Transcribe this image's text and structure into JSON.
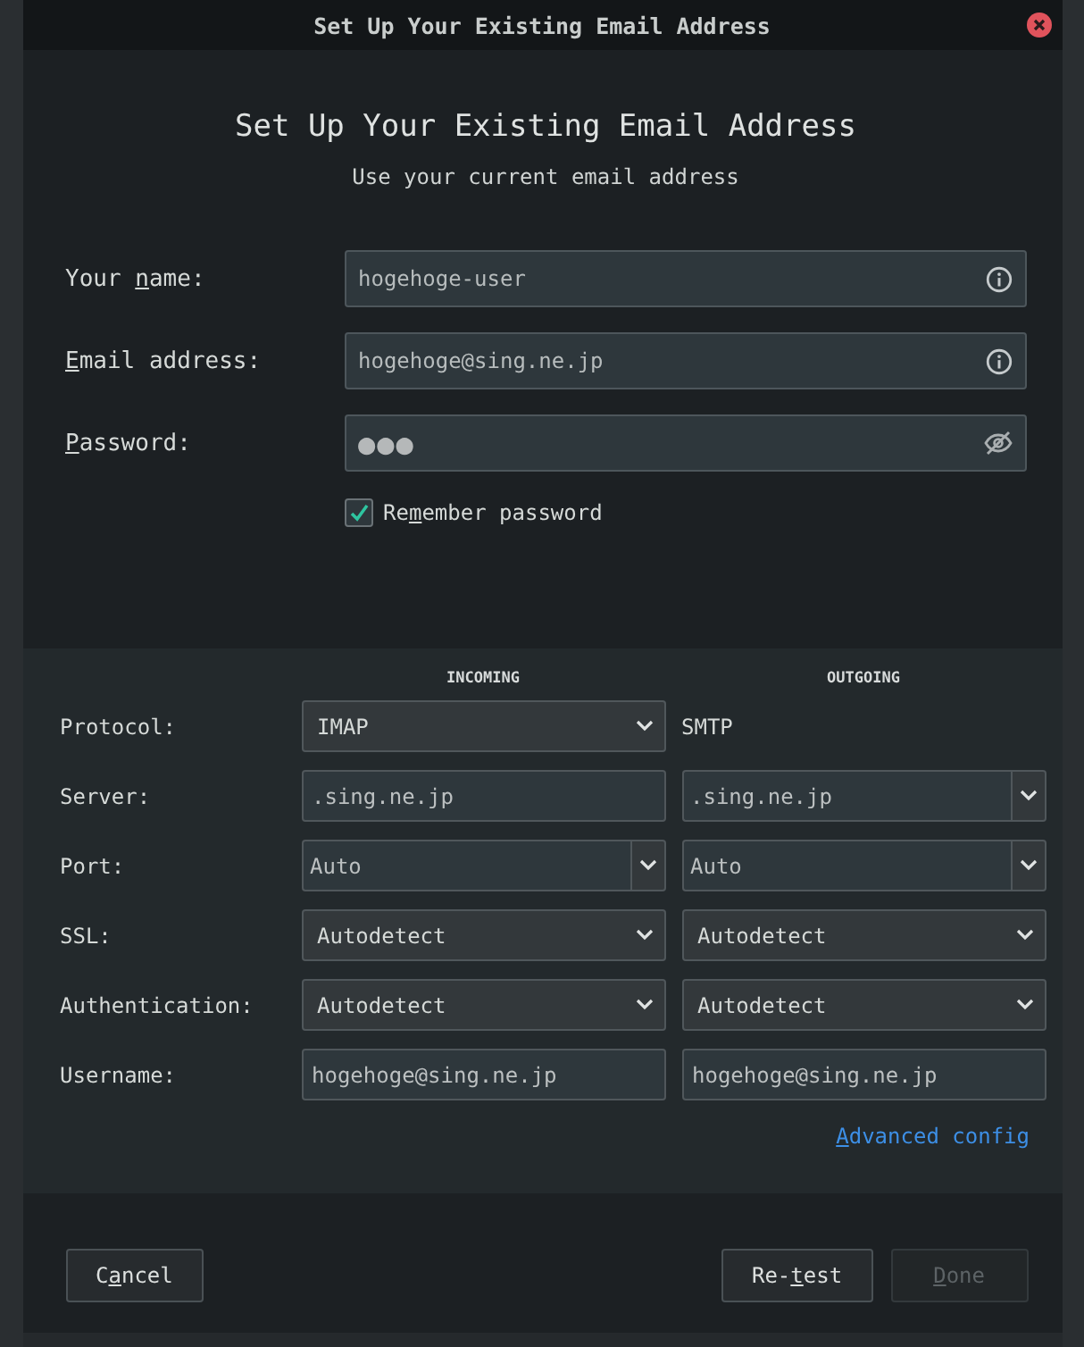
{
  "window": {
    "title": "Set Up Your Existing Email Address"
  },
  "heading": "Set Up Your Existing Email Address",
  "subheading": "Use your current email address",
  "identity_fields": [
    {
      "kind": "text",
      "label": [
        {
          "text": "Your ",
          "accesskey": false
        },
        {
          "text": "n",
          "accesskey": true
        },
        {
          "text": "ame:",
          "accesskey": false
        }
      ],
      "value": "hogehoge-user"
    },
    {
      "kind": "text",
      "label": [
        {
          "text": "E",
          "accesskey": true
        },
        {
          "text": "mail address:",
          "accesskey": false
        }
      ],
      "value": "hogehoge@sing.ne.jp"
    },
    {
      "kind": "password",
      "label": [
        {
          "text": "P",
          "accesskey": true
        },
        {
          "text": "assword:",
          "accesskey": false
        }
      ],
      "value": "●●●"
    }
  ],
  "remember_password": {
    "checked": true,
    "label": [
      {
        "text": "Re",
        "accesskey": false
      },
      {
        "text": "m",
        "accesskey": true
      },
      {
        "text": "ember password",
        "accesskey": false
      }
    ]
  },
  "server_settings": {
    "columns": [
      "INCOMING",
      "OUTGOING"
    ],
    "rows": [
      {
        "label": "Protocol:",
        "incoming": {
          "kind": "select",
          "value": "IMAP"
        },
        "outgoing": {
          "kind": "plain",
          "value": "SMTP"
        }
      },
      {
        "label": "Server:",
        "incoming": {
          "kind": "input",
          "value": ".sing.ne.jp"
        },
        "outgoing": {
          "kind": "combo",
          "value": ".sing.ne.jp"
        }
      },
      {
        "label": "Port:",
        "incoming": {
          "kind": "combo",
          "value": "Auto"
        },
        "outgoing": {
          "kind": "combo",
          "value": "Auto"
        }
      },
      {
        "label": "SSL:",
        "incoming": {
          "kind": "select",
          "value": "Autodetect"
        },
        "outgoing": {
          "kind": "select",
          "value": "Autodetect"
        }
      },
      {
        "label": "Authentication:",
        "incoming": {
          "kind": "select",
          "value": "Autodetect"
        },
        "outgoing": {
          "kind": "select",
          "value": "Autodetect"
        }
      },
      {
        "label": "Username:",
        "incoming": {
          "kind": "input",
          "value": "hogehoge@sing.ne.jp"
        },
        "outgoing": {
          "kind": "input",
          "value": "hogehoge@sing.ne.jp"
        }
      }
    ],
    "advanced_link": [
      {
        "text": "A",
        "accesskey": true
      },
      {
        "text": "dvanced config",
        "accesskey": false
      }
    ]
  },
  "footer": {
    "left_buttons": [
      {
        "disabled": false,
        "label": [
          {
            "text": "C",
            "accesskey": false
          },
          {
            "text": "a",
            "accesskey": true
          },
          {
            "text": "ncel",
            "accesskey": false
          }
        ]
      }
    ],
    "right_buttons": [
      {
        "disabled": false,
        "label": [
          {
            "text": "Re-",
            "accesskey": false
          },
          {
            "text": "t",
            "accesskey": true
          },
          {
            "text": "est",
            "accesskey": false
          }
        ]
      },
      {
        "disabled": true,
        "label": [
          {
            "text": "D",
            "accesskey": true
          },
          {
            "text": "one",
            "accesskey": false
          }
        ]
      }
    ]
  }
}
